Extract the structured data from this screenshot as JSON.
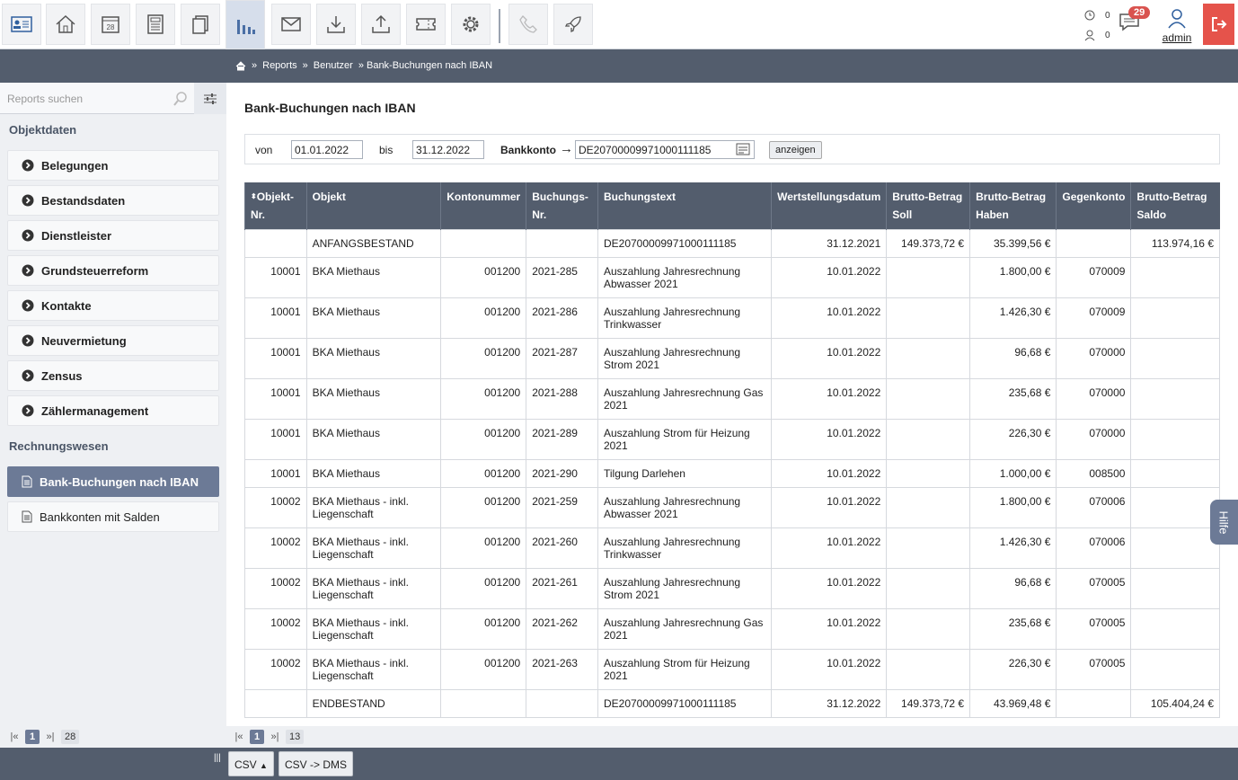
{
  "toolbar": {
    "icons": [
      "contact-card-icon",
      "home-icon",
      "calendar-icon",
      "calculator-icon",
      "documents-icon",
      "bar-chart-icon",
      "mail-icon",
      "download-icon",
      "upload-icon",
      "ticket-icon",
      "gear-icon",
      "phone-icon",
      "rocket-icon"
    ],
    "calendar_day": "28",
    "counter1": "0",
    "counter2": "0",
    "messages_badge": "29",
    "user": "admin"
  },
  "breadcrumb": {
    "sep": "»",
    "items": [
      "Reports",
      "Benutzer",
      "» Bank-Buchungen nach IBAN"
    ]
  },
  "sidebar": {
    "search_placeholder": "Reports suchen",
    "section1": "Objektdaten",
    "items": [
      "Belegungen",
      "Bestandsdaten",
      "Dienstleister",
      "Grundsteuerreform",
      "Kontakte",
      "Neuvermietung",
      "Zensus",
      "Zählermanagement"
    ],
    "section2": "Rechnungswesen",
    "reports": [
      "Bank-Buchungen nach IBAN",
      "Bankkonten mit Salden"
    ]
  },
  "main": {
    "title": "Bank-Buchungen nach IBAN",
    "filter": {
      "von_label": "von",
      "von": "01.01.2022",
      "bis_label": "bis",
      "bis": "31.12.2022",
      "konto_label": "Bankkonto",
      "konto": "DE20700009971000111185",
      "button": "anzeigen"
    },
    "columns": [
      "Objekt-Nr.",
      "Objekt",
      "Kontonummer",
      "Buchungs-Nr.",
      "Buchungstext",
      "Wertstellungsdatum",
      "Brutto-Betrag Soll",
      "Brutto-Betrag Haben",
      "Gegenkonto",
      "Brutto-Betrag Saldo"
    ],
    "rows": [
      [
        "",
        "ANFANGSBESTAND",
        "",
        "",
        "DE20700009971000111185",
        "31.12.2021",
        "149.373,72 €",
        "35.399,56 €",
        "",
        "113.974,16 €"
      ],
      [
        "10001",
        "BKA Miethaus",
        "001200",
        "2021-285",
        "Auszahlung Jahresrechnung Abwasser 2021",
        "10.01.2022",
        "",
        "1.800,00 €",
        "070009",
        ""
      ],
      [
        "10001",
        "BKA Miethaus",
        "001200",
        "2021-286",
        "Auszahlung Jahresrechnung Trinkwasser",
        "10.01.2022",
        "",
        "1.426,30 €",
        "070009",
        ""
      ],
      [
        "10001",
        "BKA Miethaus",
        "001200",
        "2021-287",
        "Auszahlung Jahresrechnung Strom 2021",
        "10.01.2022",
        "",
        "96,68 €",
        "070000",
        ""
      ],
      [
        "10001",
        "BKA Miethaus",
        "001200",
        "2021-288",
        "Auszahlung Jahresrechnung Gas 2021",
        "10.01.2022",
        "",
        "235,68 €",
        "070000",
        ""
      ],
      [
        "10001",
        "BKA Miethaus",
        "001200",
        "2021-289",
        "Auszahlung Strom für Heizung 2021",
        "10.01.2022",
        "",
        "226,30 €",
        "070000",
        ""
      ],
      [
        "10001",
        "BKA Miethaus",
        "001200",
        "2021-290",
        "Tilgung Darlehen",
        "10.01.2022",
        "",
        "1.000,00 €",
        "008500",
        ""
      ],
      [
        "10002",
        "BKA Miethaus - inkl. Liegenschaft",
        "001200",
        "2021-259",
        "Auszahlung Jahresrechnung Abwasser 2021",
        "10.01.2022",
        "",
        "1.800,00 €",
        "070006",
        ""
      ],
      [
        "10002",
        "BKA Miethaus - inkl. Liegenschaft",
        "001200",
        "2021-260",
        "Auszahlung Jahresrechnung Trinkwasser",
        "10.01.2022",
        "",
        "1.426,30 €",
        "070006",
        ""
      ],
      [
        "10002",
        "BKA Miethaus - inkl. Liegenschaft",
        "001200",
        "2021-261",
        "Auszahlung Jahresrechnung Strom 2021",
        "10.01.2022",
        "",
        "96,68 €",
        "070005",
        ""
      ],
      [
        "10002",
        "BKA Miethaus - inkl. Liegenschaft",
        "001200",
        "2021-262",
        "Auszahlung Jahresrechnung Gas 2021",
        "10.01.2022",
        "",
        "235,68 €",
        "070005",
        ""
      ],
      [
        "10002",
        "BKA Miethaus - inkl. Liegenschaft",
        "001200",
        "2021-263",
        "Auszahlung Strom für Heizung 2021",
        "10.01.2022",
        "",
        "226,30 €",
        "070005",
        ""
      ],
      [
        "",
        "ENDBESTAND",
        "",
        "",
        "DE20700009971000111185",
        "31.12.2022",
        "149.373,72 €",
        "43.969,48 €",
        "",
        "105.404,24 €"
      ]
    ]
  },
  "pager_left": {
    "first": "|«",
    "page": "1",
    "last": "»|",
    "total": "28"
  },
  "pager_main": {
    "first": "|«",
    "page": "1",
    "last": "»|",
    "total": "13"
  },
  "bottom": {
    "csv": "CSV",
    "csv_dms": "CSV -> DMS"
  },
  "help": "Hilfe"
}
